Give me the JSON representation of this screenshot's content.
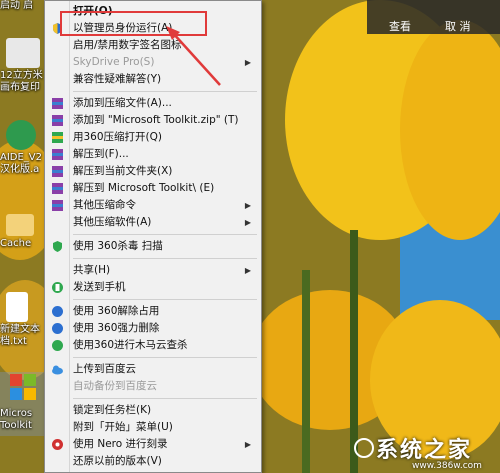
{
  "desktop": {
    "icons": [
      {
        "label": "启动 启"
      },
      {
        "label": "12立方米 画布复印"
      },
      {
        "label": "AIDE_V2 汉化版.a"
      },
      {
        "label": "Cache"
      },
      {
        "label": "新建文本 档.txt"
      },
      {
        "label": "Micros Toolkit"
      }
    ]
  },
  "topbar": {
    "btn1": "查看",
    "btn2": "取 消"
  },
  "context_menu": {
    "items": [
      {
        "label": "打开(O)",
        "bold": true
      },
      {
        "label": "以管理员身份运行(A)",
        "icon": "shield-icon"
      },
      {
        "label": "启用/禁用数字签名图标"
      },
      {
        "label": "SkyDrive Pro(S)",
        "disabled": true,
        "arrow": true
      },
      {
        "label": "兼容性疑难解答(Y)"
      },
      {
        "label": "添加到压缩文件(A)...",
        "icon": "archive-icon"
      },
      {
        "label": "添加到 \"Microsoft Toolkit.zip\" (T)",
        "icon": "archive-icon"
      },
      {
        "label": "用360压缩打开(Q)",
        "icon": "archive-icon"
      },
      {
        "label": "解压到(F)...",
        "icon": "archive-icon"
      },
      {
        "label": "解压到当前文件夹(X)",
        "icon": "archive-icon"
      },
      {
        "label": "解压到 Microsoft Toolkit\\ (E)",
        "icon": "archive-icon"
      },
      {
        "label": "其他压缩命令",
        "icon": "archive-icon",
        "arrow": true
      },
      {
        "label": "其他压缩软件(A)",
        "arrow": true
      },
      {
        "label": "使用 360杀毒 扫描",
        "icon": "antivirus-icon"
      },
      {
        "label": "共享(H)",
        "arrow": true
      },
      {
        "label": "发送到手机",
        "icon": "phone-icon"
      },
      {
        "label": "使用 360解除占用",
        "icon": "shield360-icon"
      },
      {
        "label": "使用 360强力删除",
        "icon": "shield360-icon"
      },
      {
        "label": "使用360进行木马云查杀",
        "icon": "shield360-icon"
      },
      {
        "label": "上传到百度云",
        "icon": "cloud-icon"
      },
      {
        "label": "自动备份到百度云",
        "disabled": true
      },
      {
        "label": "锁定到任务栏(K)"
      },
      {
        "label": "附到「开始」菜单(U)"
      },
      {
        "label": "使用 Nero 进行刻录",
        "icon": "nero-icon",
        "arrow": true
      },
      {
        "label": "还原以前的版本(V)"
      }
    ]
  },
  "watermark": {
    "title": "系统之家",
    "url": "www.386w.com"
  },
  "colors": {
    "highlight": "#e03a3a",
    "menu_bg": "#f1f1f1"
  }
}
